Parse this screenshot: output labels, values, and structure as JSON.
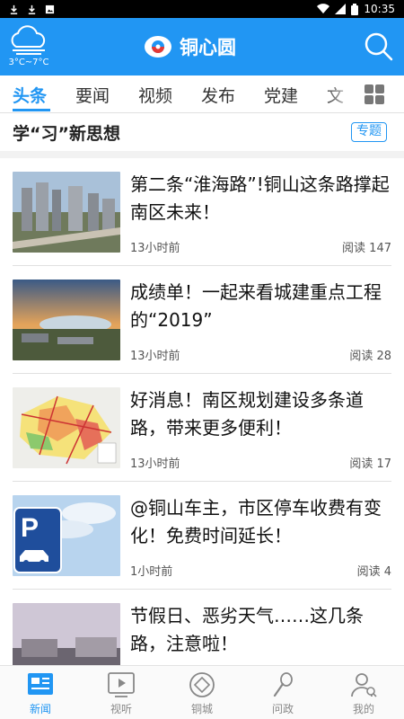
{
  "status_bar": {
    "time": "10:35",
    "left_icons": [
      "download-icon",
      "download-icon",
      "photo-icon"
    ],
    "right_icons": [
      "wifi-icon",
      "signal-icon",
      "battery-icon"
    ]
  },
  "header": {
    "weather_temp": "3°C~7°C",
    "app_name": "铜心圆",
    "bg_color": "#2196f3"
  },
  "tabs": [
    {
      "label": "头条",
      "active": true
    },
    {
      "label": "要闻",
      "active": false
    },
    {
      "label": "视频",
      "active": false
    },
    {
      "label": "发布",
      "active": false
    },
    {
      "label": "党建",
      "active": false
    },
    {
      "label": "文",
      "active": false
    }
  ],
  "section": {
    "title": "学“习”新思想",
    "badge": "专题"
  },
  "news": [
    {
      "title": "第二条“淮海路”!铜山这条路撑起南区未来！",
      "time": "13小时前",
      "reads": "阅读 147"
    },
    {
      "title": "成绩单！一起来看城建重点工程的“2019”",
      "time": "13小时前",
      "reads": "阅读 28"
    },
    {
      "title": "好消息！南区规划建设多条道路，带来更多便利！",
      "time": "13小时前",
      "reads": "阅读 17"
    },
    {
      "title": "@铜山车主，市区停车收费有变化！免费时间延长！",
      "time": "1小时前",
      "reads": "阅读 4"
    },
    {
      "title": "节假日、恶劣天气……这几条路，注意啦！",
      "time": "",
      "reads": ""
    }
  ],
  "bottom_nav": [
    {
      "label": "新闻",
      "icon": "news-icon",
      "active": true
    },
    {
      "label": "视听",
      "icon": "video-icon",
      "active": false
    },
    {
      "label": "铜城",
      "icon": "coin-icon",
      "active": false
    },
    {
      "label": "问政",
      "icon": "microphone-icon",
      "active": false
    },
    {
      "label": "我的",
      "icon": "profile-icon",
      "active": false
    }
  ],
  "colors": {
    "accent": "#2196f3",
    "text": "#111111",
    "muted": "#555555"
  }
}
